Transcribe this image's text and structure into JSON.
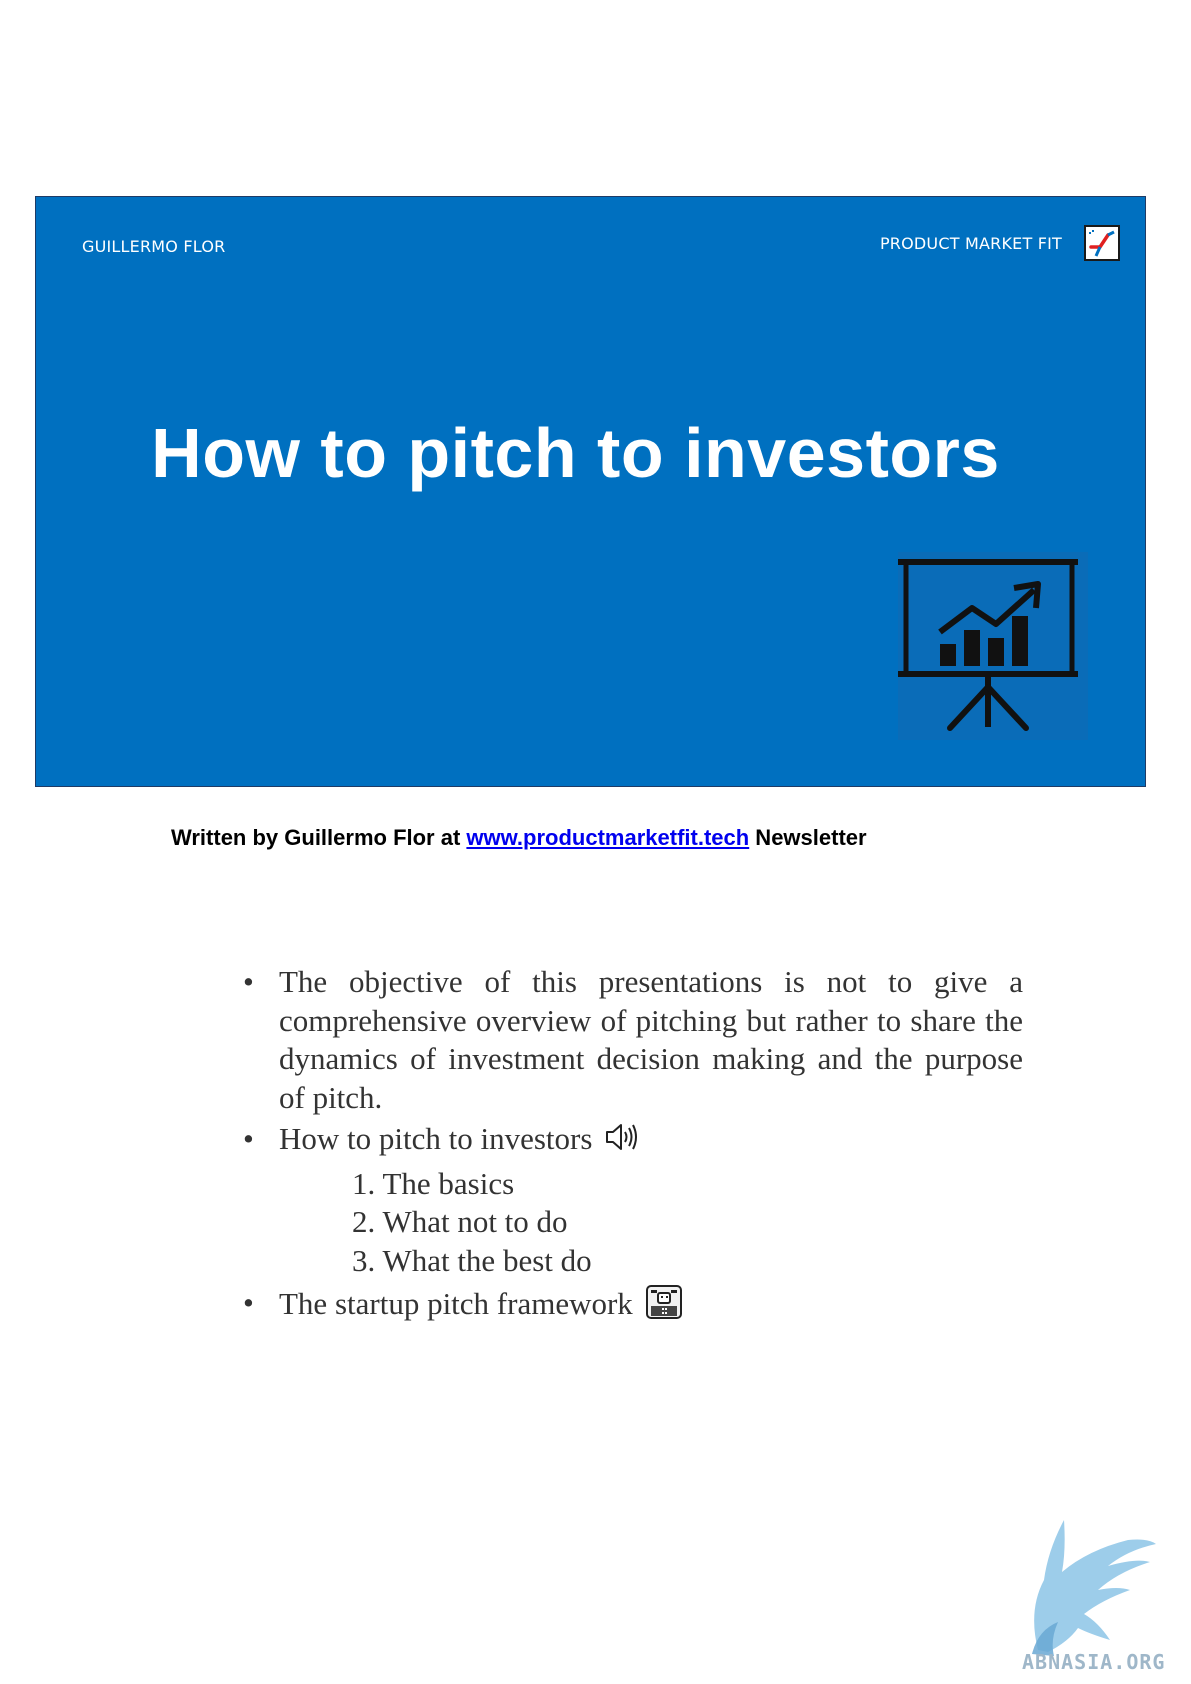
{
  "banner": {
    "author_tag": "GUILLERMO FLOR",
    "brand_tag": "PRODUCT MARKET FIT",
    "title": "How to pitch to investors",
    "background": "#0070c0"
  },
  "byline": {
    "prefix": "Written by Guillermo Flor at ",
    "link_text": "www.productmarketfit.tech",
    "suffix": " Newsletter"
  },
  "bullets": [
    {
      "text": "The objective of this presentations is not to give a comprehensive overview of pitching but rather to share the dynamics of investment decision making and the purpose of pitch."
    },
    {
      "text": "How to pitch to investors",
      "icon": "speaker-icon"
    },
    {
      "text": "The startup pitch framework",
      "icon": "robot-icon"
    }
  ],
  "sub_items": [
    "1. The basics",
    "2. What not to do",
    "3. What the best do"
  ],
  "watermark": {
    "text": "ABNASIA.ORG",
    "icon": "griffin-icon"
  }
}
